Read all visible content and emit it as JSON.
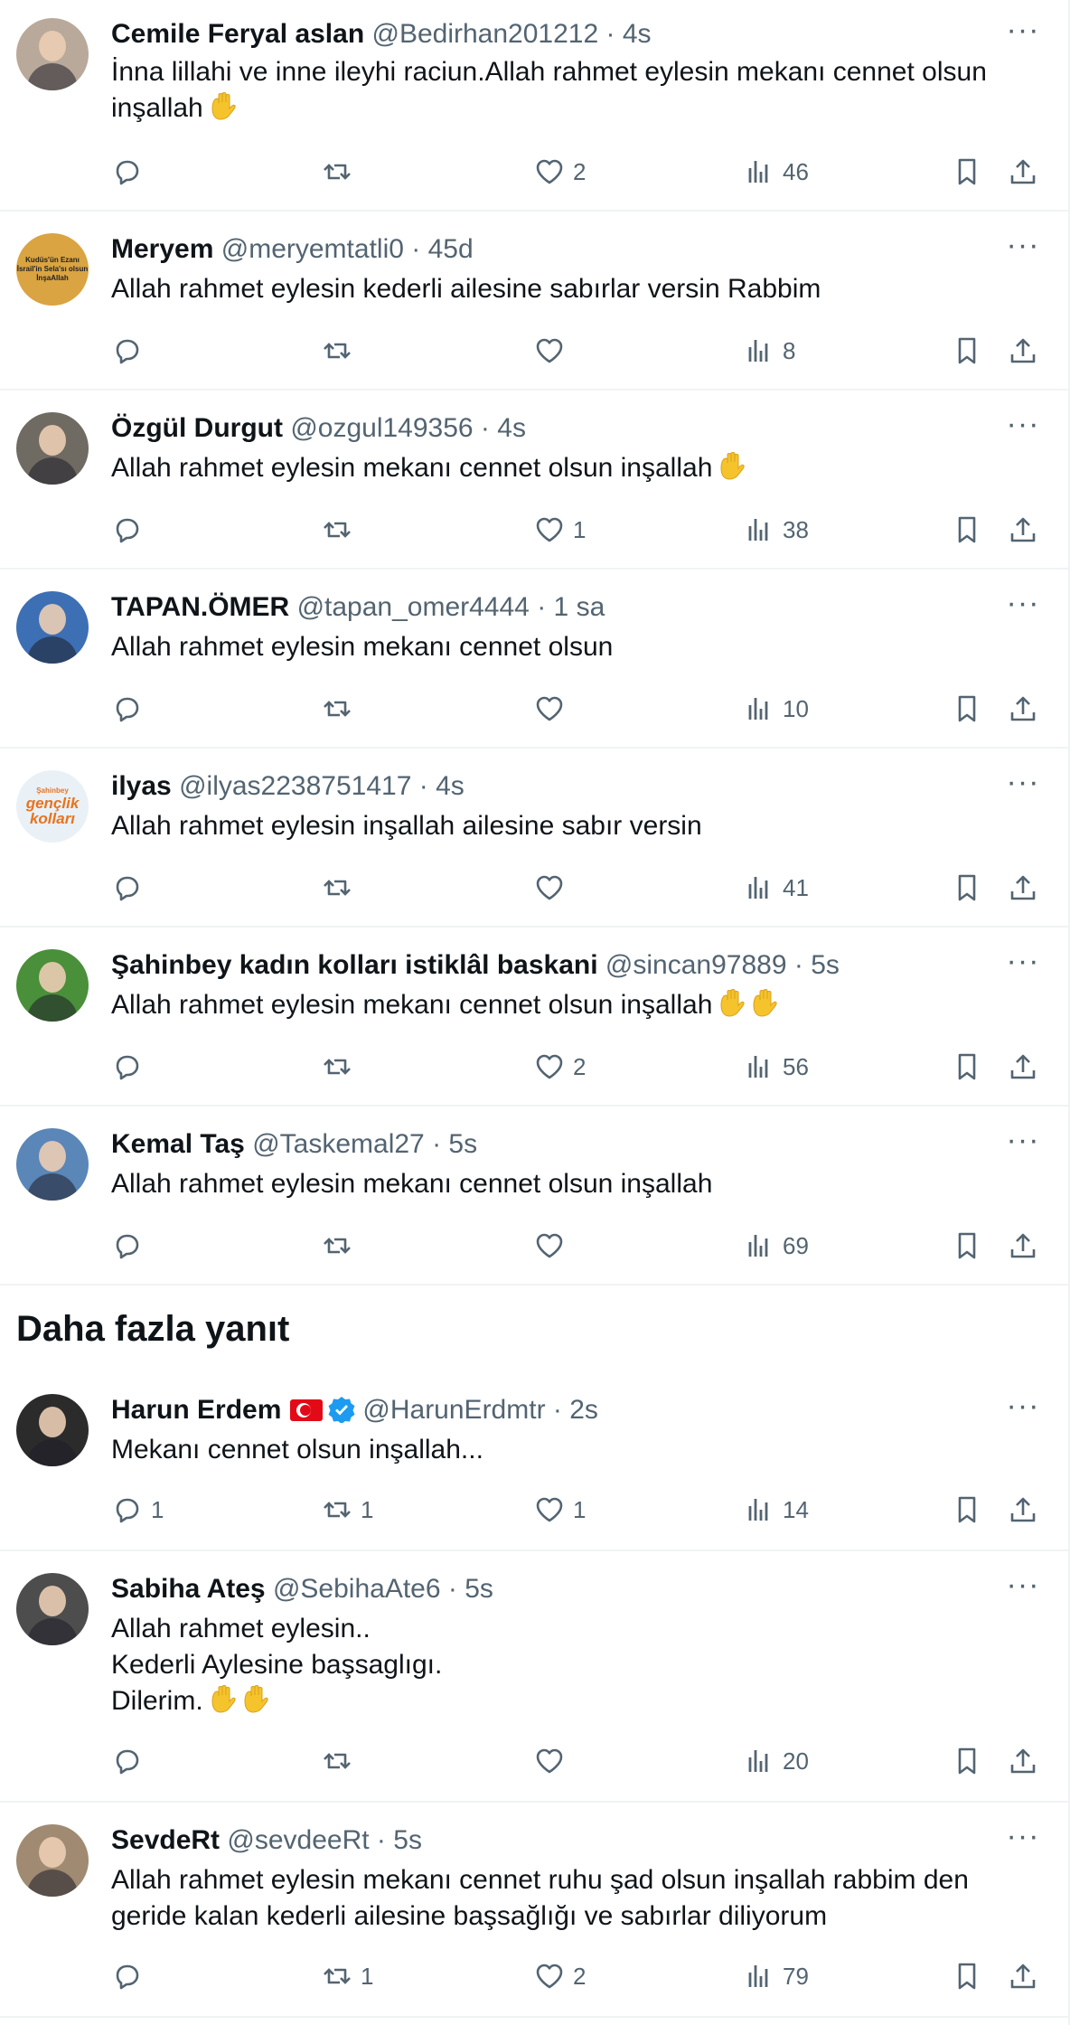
{
  "section_title": "Daha fazla yanıt",
  "tweets": [
    {
      "name": "Cemile Feryal aslan",
      "handle": "@Bedirhan201212",
      "time": "4s",
      "text": "İnna lillahi ve inne ileyhi raciun.Allah rahmet eylesin mekanı cennet olsun inşallah",
      "emoji_count": 1,
      "replies": "",
      "retweets": "",
      "likes": "2",
      "views": "46",
      "avatar_color": "#b9a99a"
    },
    {
      "name": "Meryem",
      "handle": "@meryemtatli0",
      "time": "45d",
      "text": "Allah rahmet eylesin kederli ailesine sabırlar versin Rabbim",
      "emoji_count": 0,
      "replies": "",
      "retweets": "",
      "likes": "",
      "views": "8",
      "avatar_color": "#d9a441",
      "avatar_text": [
        "Kudüs'ün Ezanı",
        "İsrail'in Sela'sı olsun",
        "İnşaAllah"
      ]
    },
    {
      "name": "Özgül Durgut",
      "handle": "@ozgul149356",
      "time": "4s",
      "text": "Allah rahmet eylesin mekanı cennet olsun inşallah",
      "emoji_count": 1,
      "replies": "",
      "retweets": "",
      "likes": "1",
      "views": "38",
      "avatar_color": "#6f6a62"
    },
    {
      "name": "TAPAN.ÖMER",
      "handle": "@tapan_omer4444",
      "time": "1 sa",
      "text": "Allah rahmet eylesin mekanı cennet olsun",
      "emoji_count": 0,
      "replies": "",
      "retweets": "",
      "likes": "",
      "views": "10",
      "avatar_color": "#3d6fb4"
    },
    {
      "name": "ilyas",
      "handle": "@ilyas2238751417",
      "time": "4s",
      "text": "Allah rahmet eylesin inşallah ailesine sabır versin",
      "emoji_count": 0,
      "replies": "",
      "retweets": "",
      "likes": "",
      "views": "41",
      "avatar_color": "#e9f1f7",
      "avatar_text": [
        "Şahinbey",
        "gençlik",
        "kolları"
      ]
    },
    {
      "name": "Şahinbey kadın kolları istiklâl baskani",
      "handle": "@sincan97889",
      "time": "5s",
      "text": "Allah rahmet eylesin mekanı cennet olsun inşallah",
      "emoji_count": 2,
      "replies": "",
      "retweets": "",
      "likes": "2",
      "views": "56",
      "avatar_color": "#4a8f3a"
    },
    {
      "name": "Kemal Taş",
      "handle": "@Taskemal27",
      "time": "5s",
      "text": "Allah rahmet eylesin mekanı cennet olsun inşallah",
      "emoji_count": 0,
      "replies": "",
      "retweets": "",
      "likes": "",
      "views": "69",
      "avatar_color": "#5b86b8"
    },
    {
      "name": "Harun Erdem",
      "handle": "@HarunErdmtr",
      "time": "2s",
      "text": "Mekanı cennet olsun inşallah...",
      "emoji_count": 0,
      "replies": "1",
      "retweets": "1",
      "likes": "1",
      "views": "14",
      "avatar_color": "#2b2b2b",
      "flag": true,
      "verified": true
    },
    {
      "name": "Sabiha Ateş",
      "handle": "@SebihaAte6",
      "time": "5s",
      "text": "Allah rahmet eylesin..\nKederli Aylesine başsaglıgı.\nDilerim.",
      "emoji_count": 2,
      "replies": "",
      "retweets": "",
      "likes": "",
      "views": "20",
      "avatar_color": "#4d4d4d"
    },
    {
      "name": "SevdeRt",
      "handle": "@sevdeeRt",
      "time": "5s",
      "text": "Allah rahmet eylesin mekanı cennet ruhu şad olsun inşallah rabbim den geride kalan kederli ailesine başsağlığı ve sabırlar diliyorum",
      "emoji_count": 0,
      "replies": "",
      "retweets": "1",
      "likes": "2",
      "views": "79",
      "avatar_color": "#a08a72"
    }
  ]
}
